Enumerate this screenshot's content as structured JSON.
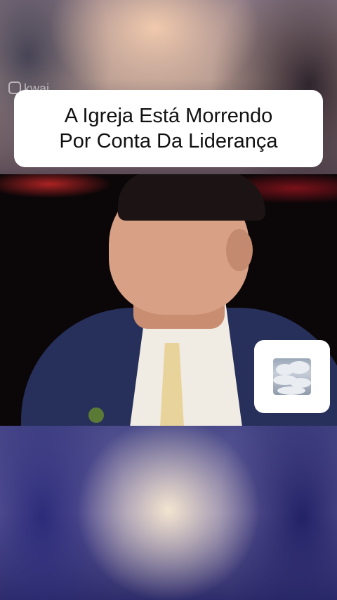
{
  "caption": {
    "line1": "A Igreja Está Morrendo",
    "line2": "Por Conta Da Liderança"
  },
  "watermark": {
    "brand": "kwai",
    "icon": "kwai-logo-icon"
  },
  "sticker": {
    "icon": "cloud-sticker-icon"
  },
  "colors": {
    "caption_bg": "#ffffff",
    "caption_text": "#111111",
    "suit": "#27305a"
  }
}
